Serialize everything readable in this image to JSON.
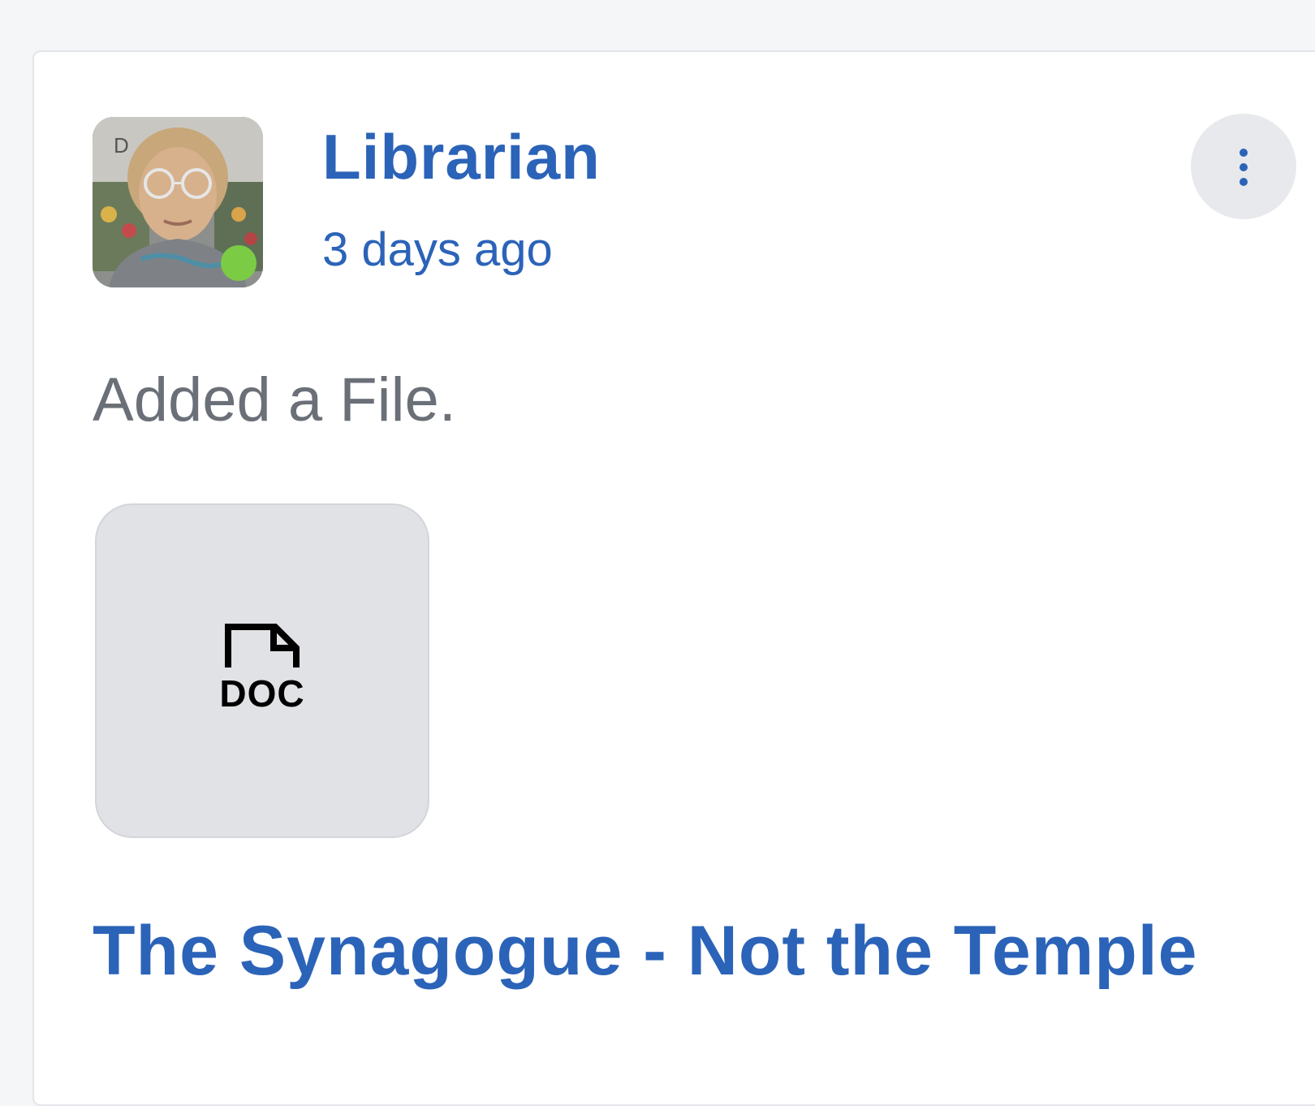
{
  "post": {
    "author_name": "Librarian",
    "timestamp": "3 days ago",
    "activity_text": "Added a File.",
    "file": {
      "type_label": "DOC",
      "title": "The Synagogue - Not the Temple"
    },
    "online_status": "online"
  },
  "colors": {
    "link": "#2b63b8",
    "online": "#7ccb45",
    "muted_text": "#6b7078",
    "tile_background": "#e1e2e5"
  },
  "icons": {
    "more": "more-vertical-icon",
    "file": "doc-file-icon"
  }
}
